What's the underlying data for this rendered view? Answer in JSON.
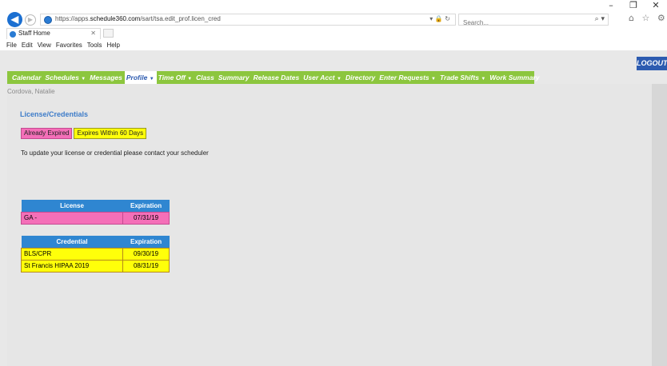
{
  "browser": {
    "window_controls": [
      "–",
      "❐",
      "✕"
    ],
    "url_prefix": "https://apps.",
    "url_domain": "schedule360.com",
    "url_path": "/sart/tsa.edit_prof.licen_cred",
    "address_icons": "▾ 🔒 ↻",
    "search_placeholder": "Search...",
    "search_icon": "⌕ ▾",
    "tool_icons": "⌂ ☆ ⚙",
    "tab_title": "Staff Home",
    "tab_close": "✕",
    "menu": [
      "File",
      "Edit",
      "View",
      "Favorites",
      "Tools",
      "Help"
    ]
  },
  "app": {
    "logout_label": "LOGOUT",
    "nav": [
      {
        "label": "Calendar",
        "dropdown": false,
        "active": false
      },
      {
        "label": "Schedules",
        "dropdown": true,
        "active": false
      },
      {
        "label": "Messages",
        "dropdown": false,
        "active": false
      },
      {
        "label": "Profile",
        "dropdown": true,
        "active": true
      },
      {
        "label": "Time Off",
        "dropdown": true,
        "active": false
      },
      {
        "label": "Class",
        "dropdown": false,
        "active": false
      },
      {
        "label": "Summary",
        "dropdown": false,
        "active": false
      },
      {
        "label": "Release Dates",
        "dropdown": false,
        "active": false
      },
      {
        "label": "User Acct",
        "dropdown": true,
        "active": false
      },
      {
        "label": "Directory",
        "dropdown": false,
        "active": false
      },
      {
        "label": "Enter Requests",
        "dropdown": true,
        "active": false
      },
      {
        "label": "Trade Shifts",
        "dropdown": true,
        "active": false
      },
      {
        "label": "Work Summary",
        "dropdown": false,
        "active": false
      }
    ],
    "user_name": "Cordova, Natalie",
    "section_title": "License/Credentials",
    "legend": {
      "expired": "Already Expired",
      "within_60": "Expires Within 60 Days",
      "expired_color": "#f46fb8",
      "within_60_color": "#ffff0a"
    },
    "info_text": "To update your license or credential please contact your scheduler",
    "license_table": {
      "headers": [
        "License",
        "Expiration"
      ],
      "rows": [
        {
          "name": "GA -",
          "expiration": "07/31/19",
          "status": "expired"
        }
      ]
    },
    "credential_table": {
      "headers": [
        "Credential",
        "Expiration"
      ],
      "rows": [
        {
          "name": "BLS/CPR",
          "expiration": "09/30/19",
          "status": "within_60"
        },
        {
          "name": "St Francis HIPAA 2019",
          "expiration": "08/31/19",
          "status": "within_60"
        }
      ]
    },
    "colors": {
      "nav_bg": "#8cc63e",
      "table_header": "#2f86d1",
      "logout_bg": "#2d5bb0",
      "title_blue": "#3d7cc9"
    }
  }
}
